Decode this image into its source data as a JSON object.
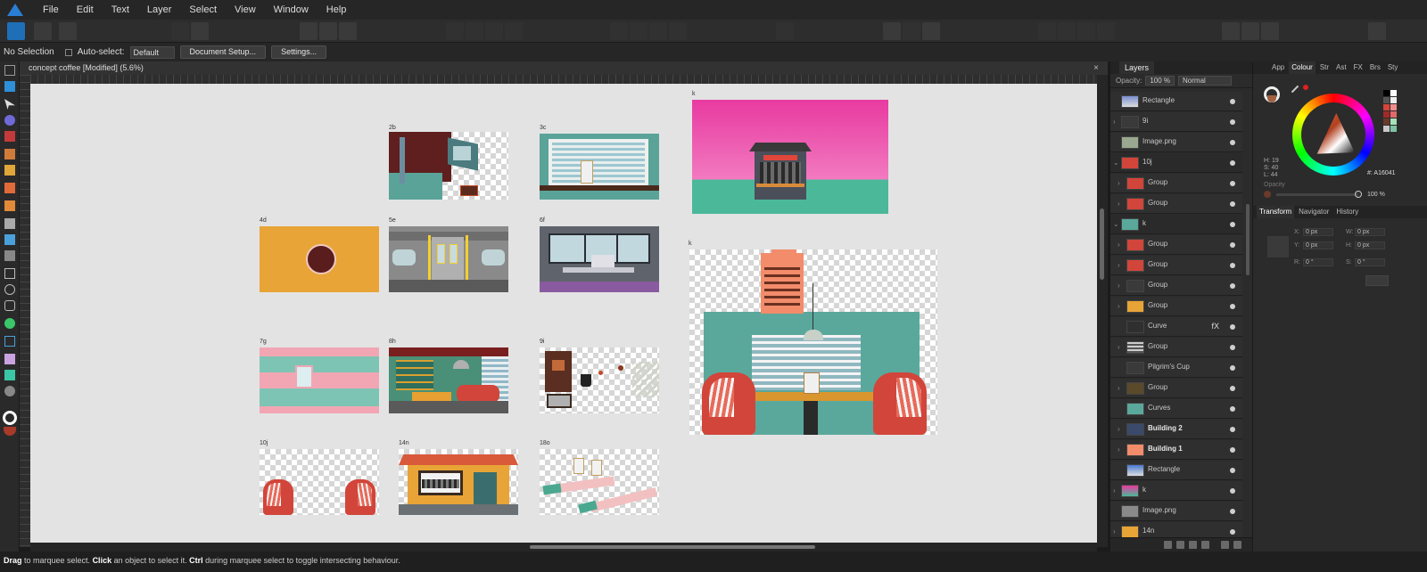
{
  "menubar": {
    "items": [
      "File",
      "Edit",
      "Text",
      "Layer",
      "Select",
      "View",
      "Window",
      "Help"
    ]
  },
  "context": {
    "selection": "No Selection",
    "auto_select_label": "Auto-select:",
    "auto_select_value": "Default",
    "doc_setup": "Document Setup...",
    "settings": "Settings..."
  },
  "document": {
    "title": "concept coffee [Modified] (5.6%)",
    "close": "×"
  },
  "artboards": {
    "a2b": "2b",
    "a3c": "3c",
    "a4d": "4d",
    "a5e": "5e",
    "a6f": "6f",
    "a7g": "7g",
    "a8h": "8h",
    "a9i": "9i",
    "a10j": "10j",
    "a14n": "14n",
    "a18o": "18o",
    "ak1": "k",
    "ak2": "k"
  },
  "layers": {
    "tab": "Layers",
    "opacity_label": "Opacity:",
    "opacity": "100 %",
    "blend": "Normal",
    "rows": [
      "Rectangle",
      "9i",
      "Image.png",
      "10j",
      "Group",
      "Group",
      "k",
      "Group",
      "Group",
      "Group",
      "Group",
      "Curve",
      "Group",
      "Pilgrim's Cup",
      "Group",
      "Curves",
      "Building 2",
      "Building 1",
      "Rectangle",
      "k",
      "Image.png",
      "14n"
    ],
    "fx": "fX"
  },
  "right_panel": {
    "tabs": [
      "App",
      "Colour",
      "Str",
      "Ast",
      "FX",
      "Brs",
      "Sty"
    ],
    "hsl": {
      "h": "H: 19",
      "s": "S: 40",
      "l": "L: 44"
    },
    "hex": "#: A16041",
    "opacity_label": "Opacity",
    "opacity": "100 %",
    "tabs2": [
      "Transform",
      "Navigator",
      "History"
    ],
    "transform": {
      "x_label": "X:",
      "x": "0 px",
      "y_label": "Y:",
      "y": "0 px",
      "w_label": "W:",
      "w": "0 px",
      "h_label": "H:",
      "h": "0 px",
      "r_label": "R:",
      "r": "0 °",
      "s_label": "S:",
      "s": "0 °"
    },
    "colors": {
      "current": "#a16041",
      "accent": "#1e6fb8"
    }
  },
  "status": {
    "drag": "Drag",
    "t1": " to marquee select. ",
    "click": "Click",
    "t2": " an object to select it. ",
    "ctrl": "Ctrl",
    "t3": " during marquee select to toggle intersecting behaviour."
  }
}
